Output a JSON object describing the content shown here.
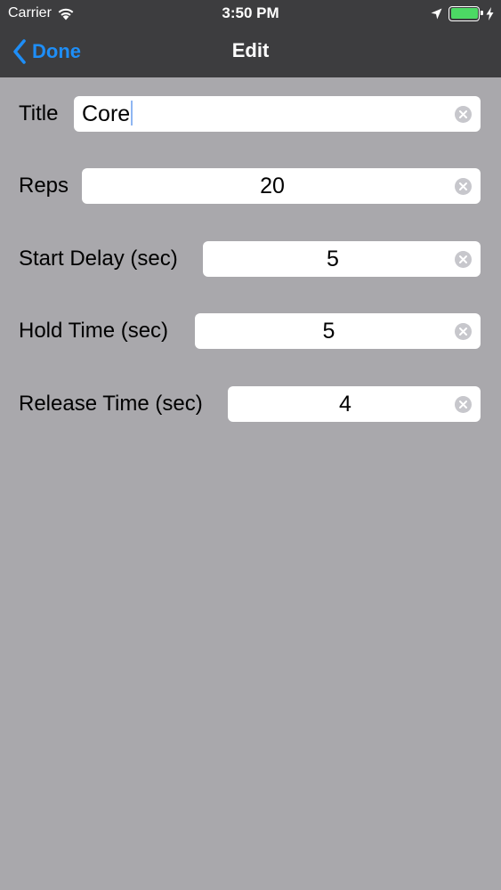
{
  "status_bar": {
    "carrier": "Carrier",
    "time": "3:50 PM",
    "icons": [
      "wifi-icon",
      "location-arrow-icon",
      "battery-icon",
      "charging-bolt-icon"
    ],
    "battery_level": 1.0
  },
  "nav": {
    "back_label": "Done",
    "title": "Edit"
  },
  "form": {
    "title": {
      "label": "Title",
      "value": "Core"
    },
    "reps": {
      "label": "Reps",
      "value": "20"
    },
    "start_delay": {
      "label": "Start Delay (sec)",
      "value": "5"
    },
    "hold_time": {
      "label": "Hold Time (sec)",
      "value": "5"
    },
    "release_time": {
      "label": "Release Time (sec)",
      "value": "4"
    }
  },
  "colors": {
    "accent": "#1e8ef7",
    "bar_background": "#3d3d3f",
    "page_background": "#a9a8ac",
    "battery": "#4cd964"
  }
}
